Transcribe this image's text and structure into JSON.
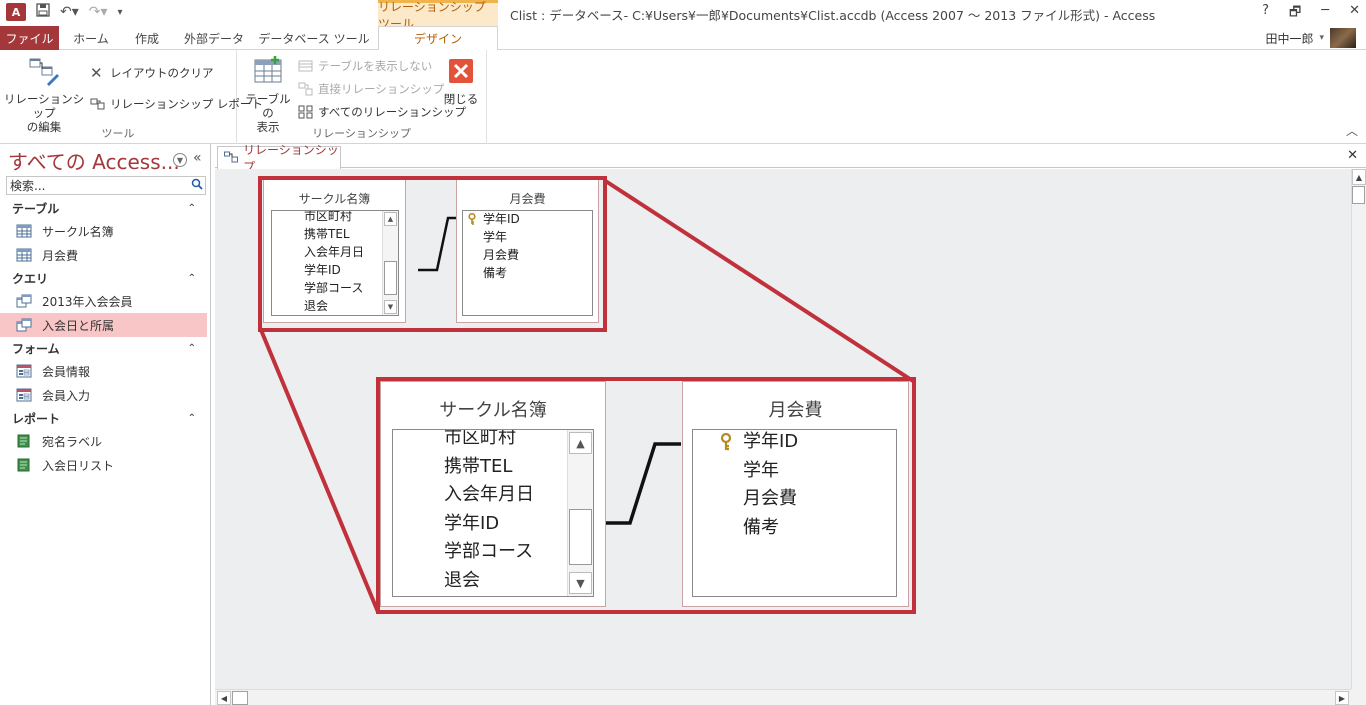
{
  "titlebar": {
    "app_logo": "A",
    "context_tools": "リレーションシップ ツール",
    "window_title": "Clist : データベース- C:¥Users¥一郎¥Documents¥Clist.accdb (Access 2007 ～ 2013 ファイル形式) - Access",
    "help": "?",
    "restore": "🗗",
    "minimize": "─",
    "close": "✕"
  },
  "tabs": {
    "file": "ファイル",
    "home": "ホーム",
    "create": "作成",
    "external": "外部データ",
    "dbtools": "データベース ツール",
    "design": "デザイン"
  },
  "user": {
    "name": "田中一郎",
    "caret": "▾"
  },
  "ribbon": {
    "tools_group": {
      "label": "ツール",
      "edit_line1": "リレーションシップ",
      "edit_line2": "の編集",
      "clear_layout": "レイアウトのクリア",
      "relationship_report": "リレーションシップ レポート"
    },
    "rel_group": {
      "label": "リレーションシップ",
      "show_table_line1": "テーブルの",
      "show_table_line2": "表示",
      "hide_table": "テーブルを表示しない",
      "direct_rel": "直接リレーションシップ",
      "all_rel": "すべてのリレーションシップ",
      "close": "閉じる"
    }
  },
  "nav": {
    "title": "すべての Access...",
    "search_placeholder": "検索...",
    "categories": [
      {
        "label": "テーブル",
        "items": [
          "サークル名簿",
          "月会費"
        ]
      },
      {
        "label": "クエリ",
        "items": [
          "2013年入会会員",
          "入会日と所属"
        ]
      },
      {
        "label": "フォーム",
        "items": [
          "会員情報",
          "会員入力"
        ]
      },
      {
        "label": "レポート",
        "items": [
          "宛名ラベル",
          "入会日リスト"
        ]
      }
    ],
    "selected_item": "入会日と所属"
  },
  "doc": {
    "tab_label": "リレーションシップ",
    "close": "✕"
  },
  "tables": {
    "circle": {
      "title": "サークル名簿",
      "fields": [
        "市区町村",
        "携帯TEL",
        "入会年月日",
        "学年ID",
        "学部コース",
        "退会"
      ]
    },
    "fee": {
      "title": "月会費",
      "fields": [
        "学年ID",
        "学年",
        "月会費",
        "備考"
      ],
      "key_field": "学年ID"
    }
  },
  "colors": {
    "accent": "#a4373a",
    "highlight": "#c0313b",
    "context_tab": "#b45f06",
    "canvas": "#eceef0",
    "selected_nav": "#f8c6c6"
  }
}
